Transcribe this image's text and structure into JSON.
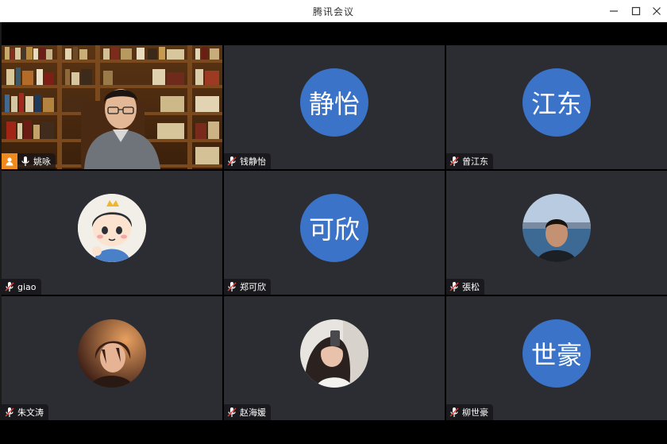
{
  "window": {
    "title": "腾讯会议",
    "controls": [
      "minimize-icon",
      "maximize-icon",
      "close-icon"
    ]
  },
  "colors": {
    "tile_bg": "#2b2d33",
    "avatar_blue": "#3a73c8",
    "host_orange": "#f08a1c",
    "muted_mic_red": "#e0413a"
  },
  "participants": [
    {
      "name": "姚咏",
      "avatar_text": "",
      "avatar_type": "video",
      "host": true,
      "mic": "on"
    },
    {
      "name": "钱静怡",
      "avatar_text": "静怡",
      "avatar_type": "text",
      "host": false,
      "mic": "muted"
    },
    {
      "name": "曾江东",
      "avatar_text": "江东",
      "avatar_type": "text",
      "host": false,
      "mic": "muted"
    },
    {
      "name": "giao",
      "avatar_text": "",
      "avatar_type": "image-cartoon",
      "host": false,
      "mic": "muted"
    },
    {
      "name": "郑可欣",
      "avatar_text": "可欣",
      "avatar_type": "text",
      "host": false,
      "mic": "muted"
    },
    {
      "name": "張松",
      "avatar_text": "",
      "avatar_type": "image-photo",
      "host": false,
      "mic": "muted"
    },
    {
      "name": "朱文涛",
      "avatar_text": "",
      "avatar_type": "image-anime",
      "host": false,
      "mic": "muted"
    },
    {
      "name": "赵海媛",
      "avatar_text": "",
      "avatar_type": "image-photo",
      "host": false,
      "mic": "muted"
    },
    {
      "name": "柳世豪",
      "avatar_text": "世豪",
      "avatar_type": "text",
      "host": false,
      "mic": "muted"
    }
  ]
}
